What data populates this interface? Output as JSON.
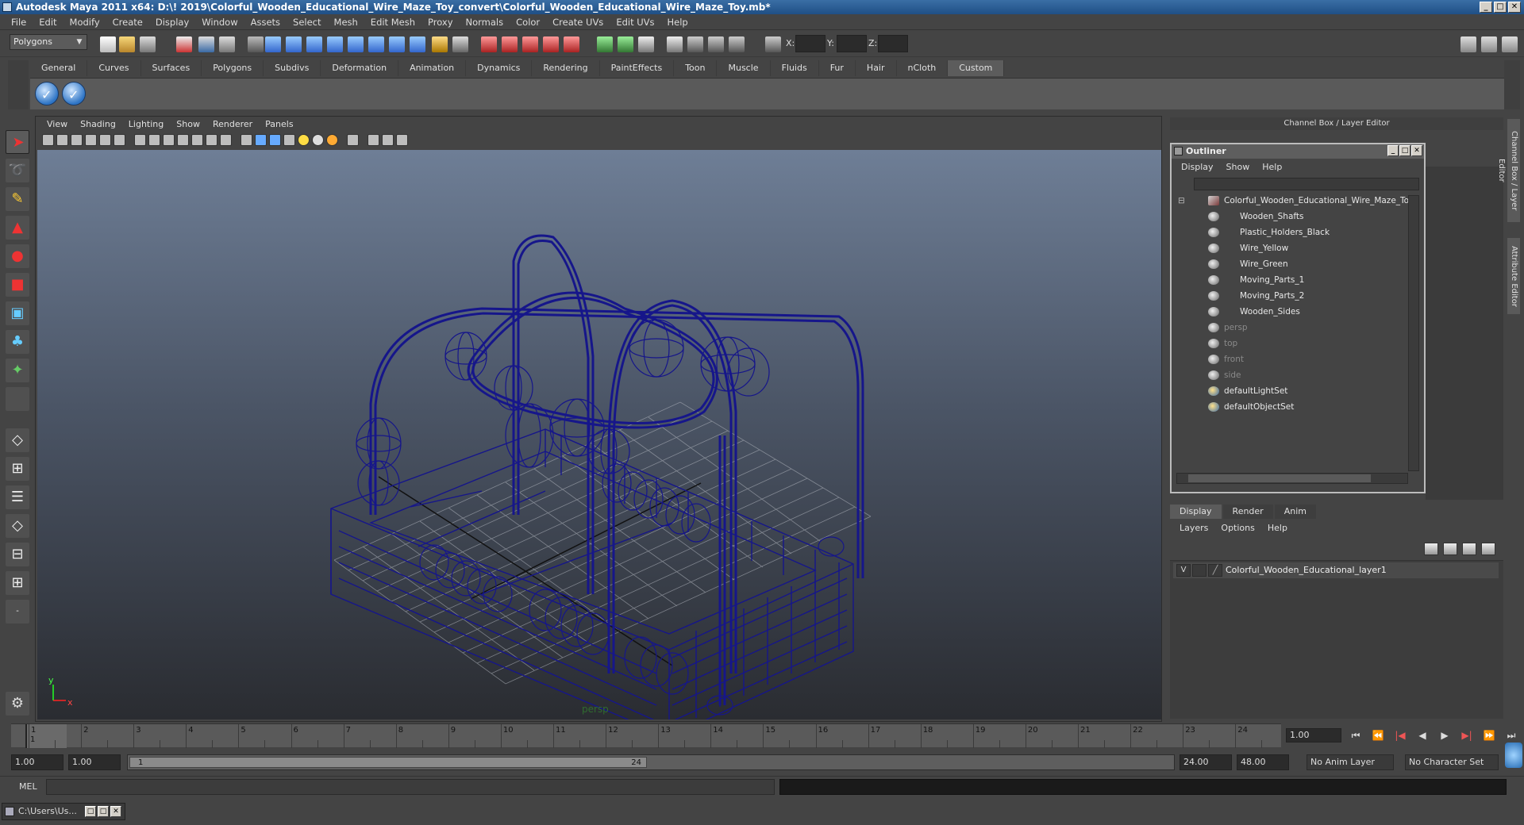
{
  "window": {
    "title": "Autodesk Maya 2011 x64: D:\\! 2019\\Colorful_Wooden_Educational_Wire_Maze_Toy_convert\\Colorful_Wooden_Educational_Wire_Maze_Toy.mb*",
    "min": "_",
    "max": "□",
    "close": "✕"
  },
  "menubar": [
    "File",
    "Edit",
    "Modify",
    "Create",
    "Display",
    "Window",
    "Assets",
    "Select",
    "Mesh",
    "Edit Mesh",
    "Proxy",
    "Normals",
    "Color",
    "Create UVs",
    "Edit UVs",
    "Help"
  ],
  "statusline": {
    "mode": "Polygons",
    "x_label": "X:",
    "y_label": "Y:",
    "z_label": "Z:"
  },
  "shelf": {
    "tabs": [
      "General",
      "Curves",
      "Surfaces",
      "Polygons",
      "Subdivs",
      "Deformation",
      "Animation",
      "Dynamics",
      "Rendering",
      "PaintEffects",
      "Toon",
      "Muscle",
      "Fluids",
      "Fur",
      "Hair",
      "nCloth",
      "Custom"
    ],
    "active_tab": "Custom",
    "check_glyph": "✓"
  },
  "viewport": {
    "menus": [
      "View",
      "Shading",
      "Lighting",
      "Show",
      "Renderer",
      "Panels"
    ],
    "camera_label": "persp",
    "axis_x": "x",
    "axis_y": "y",
    "wire_color": "#1a1a8c"
  },
  "channel_box": {
    "header": "Channel Box / Layer Editor"
  },
  "side_tabs": {
    "channel": "Channel Box / Layer Editor",
    "attribute": "Attribute Editor"
  },
  "outliner": {
    "title": "Outliner",
    "menus": [
      "Display",
      "Show",
      "Help"
    ],
    "root": "Colorful_Wooden_Educational_Wire_Maze_Toy",
    "expand_glyph": "⊟",
    "children": [
      "Wooden_Shafts",
      "Plastic_Holders_Black",
      "Wire_Yellow",
      "Wire_Green",
      "Moving_Parts_1",
      "Moving_Parts_2",
      "Wooden_Sides"
    ],
    "cameras": [
      "persp",
      "top",
      "front",
      "side"
    ],
    "sets": [
      "defaultLightSet",
      "defaultObjectSet"
    ]
  },
  "layer_editor": {
    "tabs": [
      "Display",
      "Render",
      "Anim"
    ],
    "active_tab": "Display",
    "menus": [
      "Layers",
      "Options",
      "Help"
    ],
    "layer": {
      "visible": "V",
      "color_glyph": "╱",
      "name": "Colorful_Wooden_Educational_layer1"
    }
  },
  "timeline": {
    "ticks": [
      "1",
      "2",
      "3",
      "4",
      "5",
      "6",
      "7",
      "8",
      "9",
      "10",
      "11",
      "12",
      "13",
      "14",
      "15",
      "16",
      "17",
      "18",
      "19",
      "20",
      "21",
      "22",
      "23",
      "24"
    ],
    "current_frame_marker": "1",
    "current_frame": "1.00",
    "playback": [
      "⏮",
      "⏪",
      "|◀",
      "◀",
      "▶",
      "▶|",
      "⏩",
      "⏭"
    ]
  },
  "range": {
    "start": "1.00",
    "playback_start": "1.00",
    "handle_start": "1",
    "handle_end": "24",
    "playback_end": "24.00",
    "end": "48.00",
    "anim_layer": "No Anim Layer",
    "character_set": "No Character Set"
  },
  "command_line": {
    "label": "MEL"
  },
  "taskbar": {
    "item": "C:\\Users\\Us..."
  }
}
